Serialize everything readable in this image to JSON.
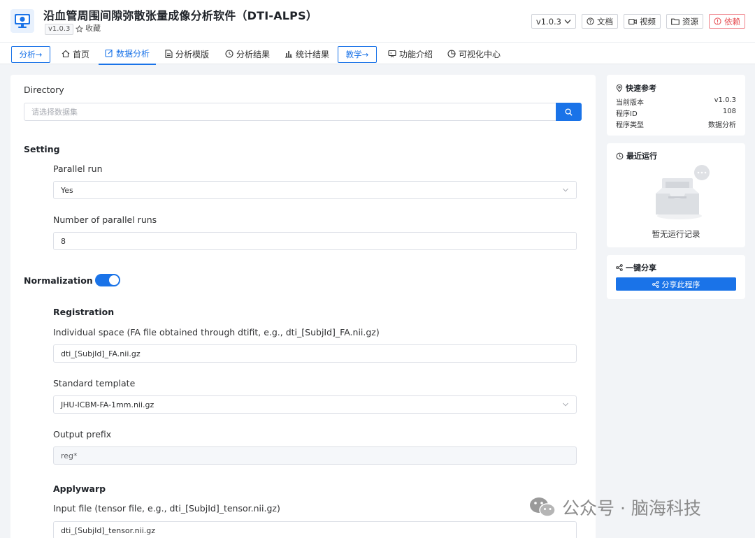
{
  "header": {
    "title": "沿血管周围间隙弥散张量成像分析软件（DTI-ALPS）",
    "version_tag": "v1.0.3",
    "favorite_label": "收藏",
    "version_select": "v1.0.3",
    "buttons": {
      "docs": "文档",
      "video": "视频",
      "resources": "资源",
      "deps": "依赖"
    }
  },
  "nav": {
    "analysis_btn": "分析→",
    "items": {
      "home": "首页",
      "data_analysis": "数据分析",
      "template": "分析模版",
      "results": "分析结果",
      "stats": "统计结果"
    },
    "teaching_btn": "教学→",
    "items2": {
      "intro": "功能介绍",
      "viz": "可视化中心"
    }
  },
  "form": {
    "directory_label": "Directory",
    "directory_placeholder": "请选择数据集",
    "setting_title": "Setting",
    "parallel_label": "Parallel run",
    "parallel_value": "Yes",
    "num_parallel_label": "Number of parallel runs",
    "num_parallel_value": "8",
    "normalization_title": "Normalization",
    "normalization_on": true,
    "registration_title": "Registration",
    "individual_label": "Individual space (FA file obtained through dtifit, e.g., dti_[SubjId]_FA.nii.gz)",
    "individual_value": "dti_[SubjId]_FA.nii.gz",
    "template_label": "Standard template",
    "template_value": "JHU-ICBM-FA-1mm.nii.gz",
    "prefix_label": "Output prefix",
    "prefix_value": "reg*",
    "applywarp_title": "Applywarp",
    "input_label": "Input file (tensor file, e.g., dti_[SubjId]_tensor.nii.gz)",
    "input_value": "dti_[SubjId]_tensor.nii.gz"
  },
  "quick_ref": {
    "title": "快速参考",
    "rows": [
      {
        "key": "当前版本",
        "value": "v1.0.3"
      },
      {
        "key": "程序ID",
        "value": "108"
      },
      {
        "key": "程序类型",
        "value": "数据分析"
      }
    ]
  },
  "recent": {
    "title": "最近运行",
    "empty_text": "暂无运行记录"
  },
  "share": {
    "title": "一键分享",
    "button": "分享此程序"
  },
  "watermark": {
    "text": "公众号 · 脑海科技"
  },
  "colors": {
    "primary": "#1a73e8",
    "danger": "#e5484d",
    "background": "#f2f4f7"
  }
}
